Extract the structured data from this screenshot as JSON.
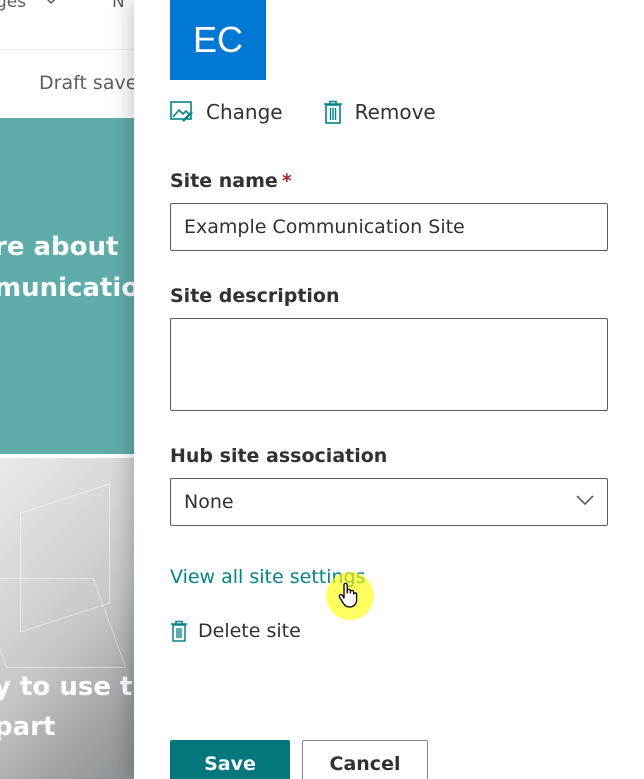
{
  "background": {
    "nav_fragment": "ges",
    "nav_fragment_2": "N",
    "draft_status": "Draft saved",
    "hero_line1": "re about",
    "hero_line2": "municatio",
    "image_line1": "y to use the",
    "image_line2": " part",
    "hero_color": "#5fadab"
  },
  "panel": {
    "logo": {
      "text": "EC",
      "color": "#0078d4"
    },
    "change_label": "Change",
    "remove_label": "Remove",
    "site_name": {
      "label": "Site name",
      "required_mark": "*",
      "value": "Example Communication Site"
    },
    "site_description": {
      "label": "Site description",
      "value": ""
    },
    "hub_site": {
      "label": "Hub site association",
      "selected": "None"
    },
    "view_all_link": "View all site settings",
    "delete_label": "Delete site",
    "save_label": "Save",
    "cancel_label": "Cancel",
    "accent_color": "#03787c",
    "link_color": "#038387"
  },
  "icons": {
    "change": "image-edit-icon",
    "remove": "trash-icon",
    "delete": "trash-icon",
    "dropdown": "chevron-down-icon",
    "cursor": "hand-pointer-icon"
  }
}
